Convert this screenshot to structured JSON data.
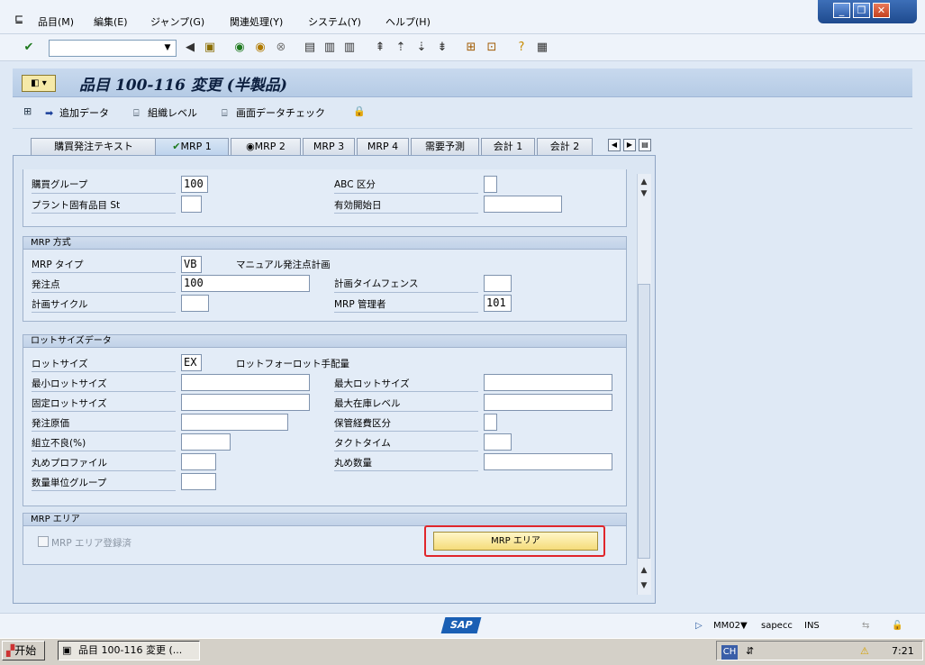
{
  "menu": {
    "items": [
      "品目(M)",
      "編集(E)",
      "ジャンプ(G)",
      "関連処理(Y)",
      "システム(Y)",
      "ヘルプ(H)"
    ]
  },
  "window_controls": {
    "minimize": "_",
    "restore": "❐",
    "close": "✕"
  },
  "toolbar": {
    "command_field_value": ""
  },
  "title": {
    "text": "品目 100-116 変更 (半製品)"
  },
  "app_toolbar": {
    "additional_data": "追加データ",
    "org_levels": "組織レベル",
    "check_screen_data": "画面データチェック"
  },
  "tabs": [
    {
      "label": "購買発注テキスト"
    },
    {
      "label": "MRP 1"
    },
    {
      "label": "MRP 2"
    },
    {
      "label": "MRP 3"
    },
    {
      "label": "MRP 4"
    },
    {
      "label": "需要予測"
    },
    {
      "label": "会計 1"
    },
    {
      "label": "会計 2"
    }
  ],
  "group_top": {
    "purchasing_group_label": "購買グループ",
    "purchasing_group_value": "100",
    "plant_status_label": "プラント固有品目 St",
    "plant_status_value": "",
    "abc_label": "ABC 区分",
    "abc_value": "",
    "valid_from_label": "有効開始日",
    "valid_from_value": ""
  },
  "group_mrp": {
    "title": "MRP 方式",
    "mrp_type_label": "MRP タイプ",
    "mrp_type_value": "VB",
    "mrp_type_desc": "マニュアル発注点計画",
    "reorder_point_label": "発注点",
    "reorder_point_value": "100",
    "planning_fence_label": "計画タイムフェンス",
    "planning_fence_value": "",
    "planning_cycle_label": "計画サイクル",
    "planning_cycle_value": "",
    "mrp_controller_label": "MRP 管理者",
    "mrp_controller_value": "101"
  },
  "group_lot": {
    "title": "ロットサイズデータ",
    "lot_size_label": "ロットサイズ",
    "lot_size_value": "EX",
    "lot_size_desc": "ロットフォーロット手配量",
    "min_lot_label": "最小ロットサイズ",
    "max_lot_label": "最大ロットサイズ",
    "fixed_lot_label": "固定ロットサイズ",
    "max_stock_label": "最大在庫レベル",
    "ordering_cost_label": "発注原価",
    "storage_cost_label": "保管経費区分",
    "assembly_scrap_label": "組立不良(%)",
    "takt_time_label": "タクトタイム",
    "rounding_profile_label": "丸めプロファイル",
    "rounding_value_label": "丸め数量",
    "unit_group_label": "数量単位グループ"
  },
  "group_mrp_area": {
    "title": "MRP エリア",
    "checkbox_label": "MRP エリア登録済",
    "button_label": "MRP エリア"
  },
  "status": {
    "tcode": "MM02",
    "system": "sapecc",
    "mode": "INS"
  },
  "taskbar": {
    "start_label": "开始",
    "task_label": "品目 100-116 変更 (...",
    "ime": "CH",
    "clock": "7:21"
  },
  "colors": {
    "highlight": "#e0262b",
    "button": "#f5dc7a",
    "sap_blue": "#1a5fb4"
  }
}
